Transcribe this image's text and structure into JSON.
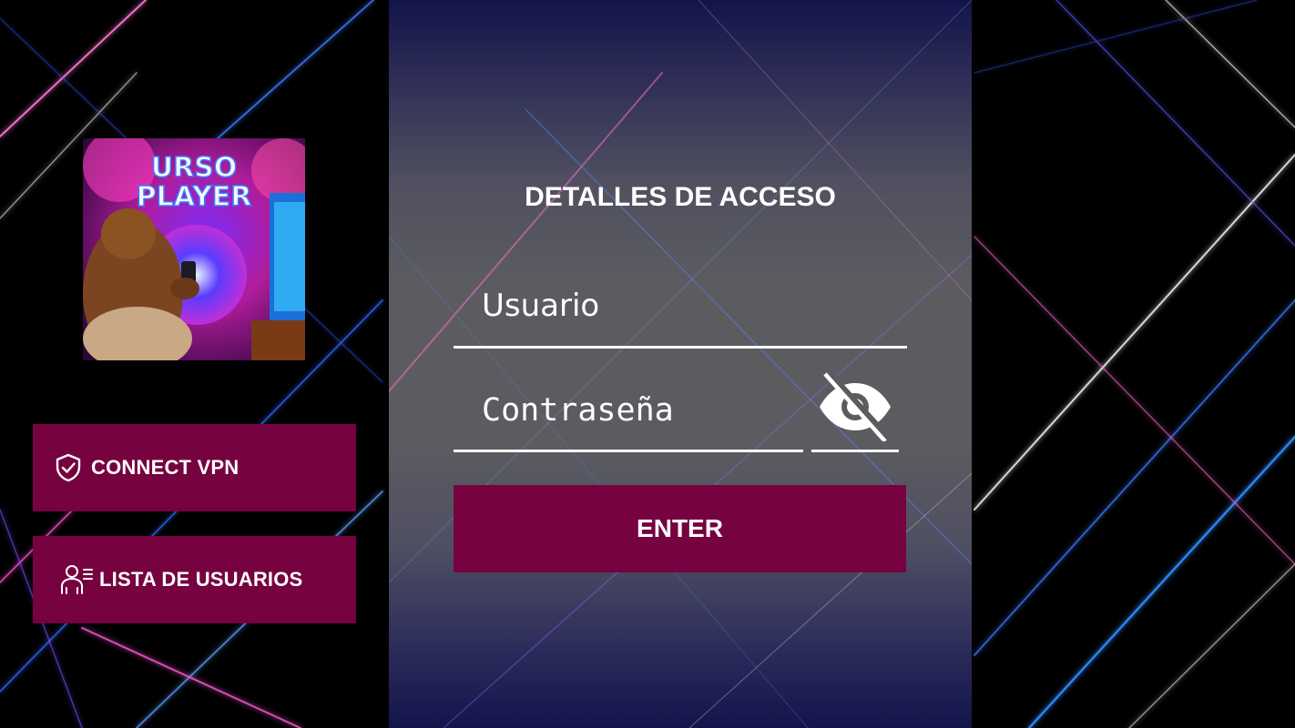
{
  "logo": {
    "line1": "URSO",
    "line2": "PLAYER"
  },
  "sidebar": {
    "vpn_button": {
      "label": "CONNECT VPN",
      "icon": "shield-check-icon"
    },
    "users_button": {
      "label": "LISTA DE USUARIOS",
      "icon": "user-list-icon"
    }
  },
  "login": {
    "title": "DETALLES DE ACCESO",
    "username_placeholder": "Usuario",
    "password_placeholder": "Contraseña",
    "toggle_icon": "eye-off-icon",
    "enter_label": "ENTER"
  },
  "colors": {
    "accent": "#76023f",
    "panel_top": "#13144a",
    "panel_mid": "#5c5c60",
    "text": "#ffffff"
  }
}
